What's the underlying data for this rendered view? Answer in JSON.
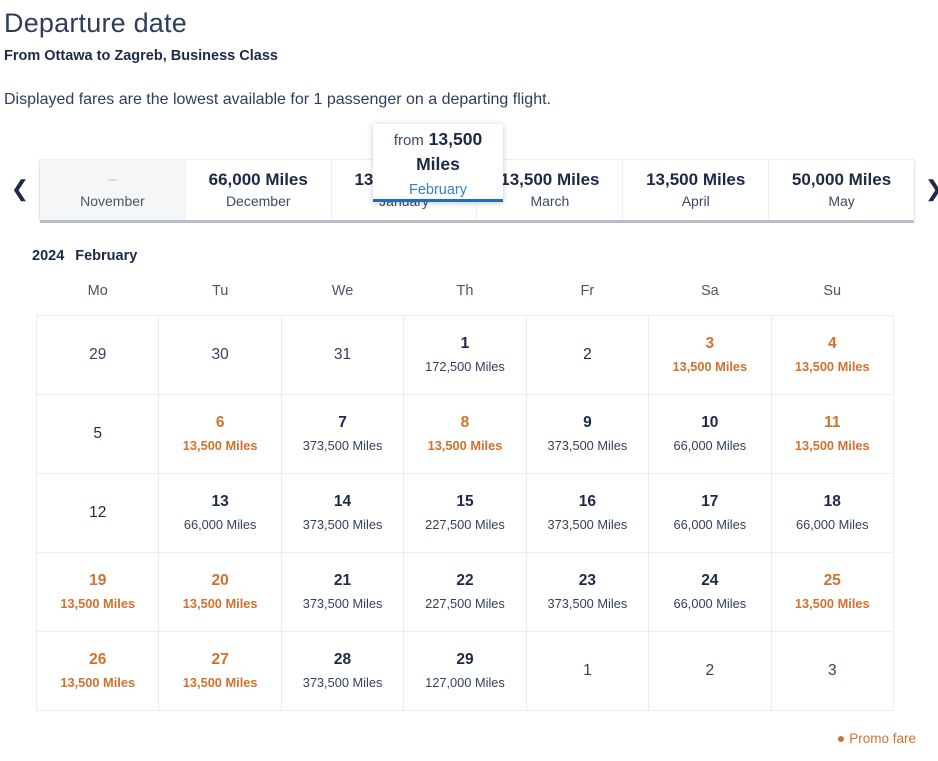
{
  "header": {
    "title": "Departure date",
    "subtitle": "From Ottawa to Zagreb, Business Class",
    "note": "Displayed fares are the lowest available for 1 passenger on a departing flight."
  },
  "carousel": {
    "prev_icon": "chevron-left-icon",
    "next_icon": "chevron-right-icon",
    "months": [
      {
        "name": "November",
        "fare": "–",
        "state": "disabled"
      },
      {
        "name": "December",
        "fare": "66,000 Miles",
        "state": "normal"
      },
      {
        "name": "January",
        "fare": "13,500 Miles",
        "state": "normal"
      },
      {
        "name": "March",
        "fare": "13,500 Miles",
        "state": "normal"
      },
      {
        "name": "April",
        "fare": "13,500 Miles",
        "state": "normal"
      },
      {
        "name": "May",
        "fare": "50,000 Miles",
        "state": "normal"
      }
    ],
    "active": {
      "name": "February",
      "from_label": "from",
      "fare": "13,500 Miles"
    }
  },
  "calendar": {
    "year": "2024",
    "month": "February",
    "weekdays": [
      "Mo",
      "Tu",
      "We",
      "Th",
      "Fr",
      "Sa",
      "Su"
    ],
    "weeks": [
      [
        {
          "day": "29",
          "fare": "",
          "type": "muted"
        },
        {
          "day": "30",
          "fare": "",
          "type": "muted"
        },
        {
          "day": "31",
          "fare": "",
          "type": "muted"
        },
        {
          "day": "1",
          "fare": "172,500 Miles",
          "type": "normal"
        },
        {
          "day": "2",
          "fare": "",
          "type": "nofare"
        },
        {
          "day": "3",
          "fare": "13,500 Miles",
          "type": "promo"
        },
        {
          "day": "4",
          "fare": "13,500 Miles",
          "type": "promo"
        }
      ],
      [
        {
          "day": "5",
          "fare": "",
          "type": "nofare"
        },
        {
          "day": "6",
          "fare": "13,500 Miles",
          "type": "promo"
        },
        {
          "day": "7",
          "fare": "373,500 Miles",
          "type": "normal"
        },
        {
          "day": "8",
          "fare": "13,500 Miles",
          "type": "promo"
        },
        {
          "day": "9",
          "fare": "373,500 Miles",
          "type": "normal"
        },
        {
          "day": "10",
          "fare": "66,000 Miles",
          "type": "normal"
        },
        {
          "day": "11",
          "fare": "13,500 Miles",
          "type": "promo"
        }
      ],
      [
        {
          "day": "12",
          "fare": "",
          "type": "nofare"
        },
        {
          "day": "13",
          "fare": "66,000 Miles",
          "type": "normal"
        },
        {
          "day": "14",
          "fare": "373,500 Miles",
          "type": "normal"
        },
        {
          "day": "15",
          "fare": "227,500 Miles",
          "type": "normal"
        },
        {
          "day": "16",
          "fare": "373,500 Miles",
          "type": "normal"
        },
        {
          "day": "17",
          "fare": "66,000 Miles",
          "type": "normal"
        },
        {
          "day": "18",
          "fare": "66,000 Miles",
          "type": "normal"
        }
      ],
      [
        {
          "day": "19",
          "fare": "13,500 Miles",
          "type": "promo"
        },
        {
          "day": "20",
          "fare": "13,500 Miles",
          "type": "promo"
        },
        {
          "day": "21",
          "fare": "373,500 Miles",
          "type": "normal"
        },
        {
          "day": "22",
          "fare": "227,500 Miles",
          "type": "normal"
        },
        {
          "day": "23",
          "fare": "373,500 Miles",
          "type": "normal"
        },
        {
          "day": "24",
          "fare": "66,000 Miles",
          "type": "normal"
        },
        {
          "day": "25",
          "fare": "13,500 Miles",
          "type": "promo"
        }
      ],
      [
        {
          "day": "26",
          "fare": "13,500 Miles",
          "type": "promo"
        },
        {
          "day": "27",
          "fare": "13,500 Miles",
          "type": "promo"
        },
        {
          "day": "28",
          "fare": "373,500 Miles",
          "type": "normal"
        },
        {
          "day": "29",
          "fare": "127,000 Miles",
          "type": "normal"
        },
        {
          "day": "1",
          "fare": "",
          "type": "muted"
        },
        {
          "day": "2",
          "fare": "",
          "type": "muted"
        },
        {
          "day": "3",
          "fare": "",
          "type": "muted"
        }
      ]
    ]
  },
  "legend": {
    "promo_label": "Promo fare"
  },
  "colors": {
    "promo": "#d2712e",
    "accent": "#1c6fbd",
    "text": "#1b2a47"
  }
}
